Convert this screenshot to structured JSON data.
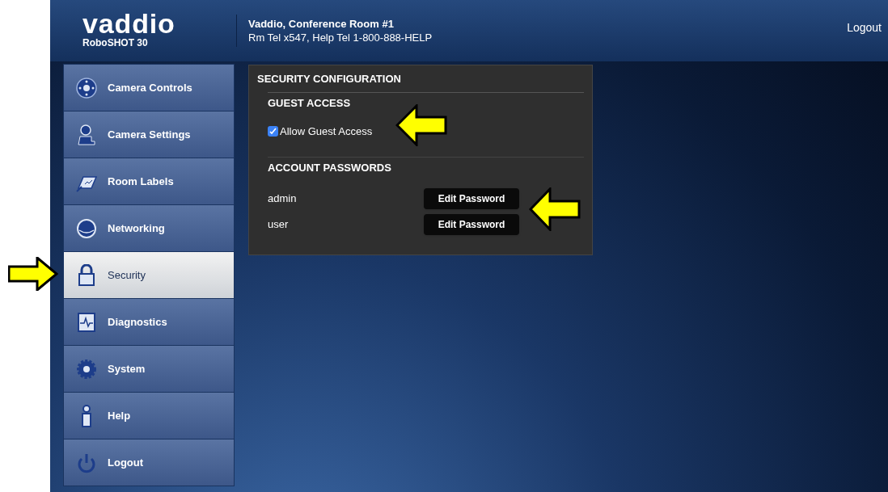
{
  "header": {
    "logo": "vaddio",
    "model": "RoboSHOT 30",
    "room_name": "Vaddio, Conference Room #1",
    "room_phone": "Rm Tel x547, Help Tel 1-800-888-HELP",
    "logout": "Logout"
  },
  "sidebar": {
    "items": [
      {
        "label": "Camera Controls",
        "selected": false
      },
      {
        "label": "Camera Settings",
        "selected": false
      },
      {
        "label": "Room Labels",
        "selected": false
      },
      {
        "label": "Networking",
        "selected": false
      },
      {
        "label": "Security",
        "selected": true
      },
      {
        "label": "Diagnostics",
        "selected": false
      },
      {
        "label": "System",
        "selected": false
      },
      {
        "label": "Help",
        "selected": false
      },
      {
        "label": "Logout",
        "selected": false
      }
    ]
  },
  "panel": {
    "title": "SECURITY CONFIGURATION",
    "guest_access": {
      "title": "GUEST ACCESS",
      "checkbox": {
        "label": "Allow Guest Access",
        "checked": true
      }
    },
    "account_passwords": {
      "title": "ACCOUNT PASSWORDS",
      "accounts": [
        {
          "name": "admin",
          "button": "Edit Password"
        },
        {
          "name": "user",
          "button": "Edit Password"
        }
      ]
    }
  }
}
